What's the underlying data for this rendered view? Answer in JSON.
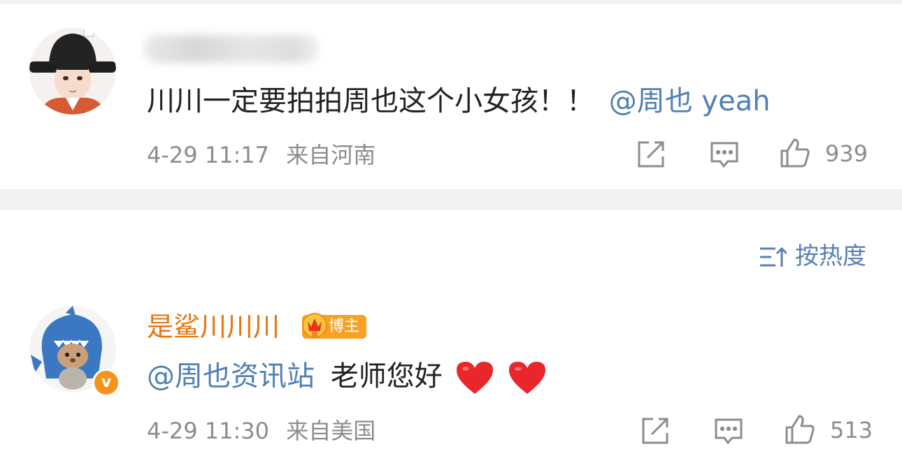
{
  "comments": [
    {
      "username": "",
      "text": "川川一定要拍拍周也这个小女孩！！",
      "mention": "@周也 yeah",
      "date": "4-29 11:17",
      "location": "来自河南",
      "likes": "939"
    },
    {
      "username": "是鲨川川川",
      "badge": "博主",
      "verified_mark": "v",
      "mention": "@周也资讯站",
      "text": "老师您好",
      "date": "4-29 11:30",
      "location": "来自美国",
      "likes": "513"
    }
  ],
  "sort": {
    "label": "按热度"
  },
  "icons": {
    "repost": "repost-icon",
    "comment": "comment-icon",
    "like": "thumbs-up-icon",
    "sort": "sort-icon",
    "heart": "heart-emoji-icon"
  },
  "colors": {
    "mention": "#4f7fb4",
    "vip_username": "#e8740c",
    "meta_gray": "#8c8c8c",
    "badge_orange": "#f7a224",
    "heart": "#e8262c"
  }
}
